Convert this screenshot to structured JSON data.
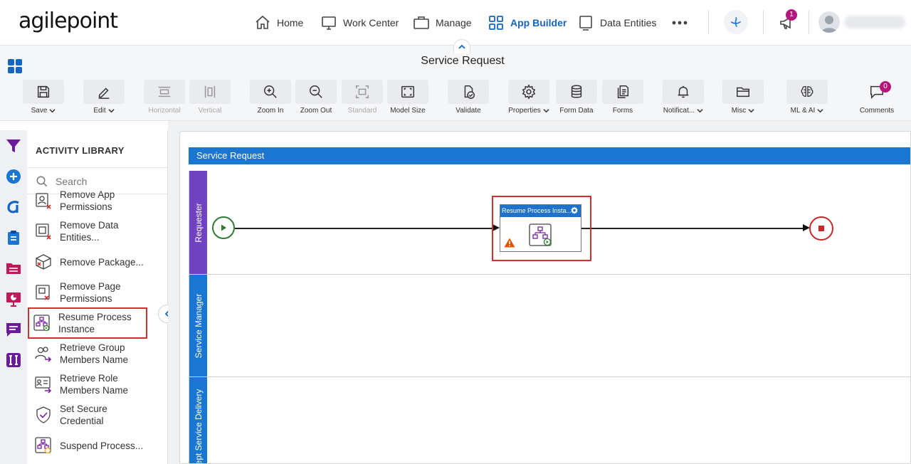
{
  "header": {
    "logo": "agilepoint",
    "nav": [
      {
        "label": "Home",
        "icon": "home-icon"
      },
      {
        "label": "Work Center",
        "icon": "monitor-icon"
      },
      {
        "label": "Manage",
        "icon": "briefcase-icon"
      },
      {
        "label": "App Builder",
        "icon": "app-grid-icon",
        "active": true
      },
      {
        "label": "Data Entities",
        "icon": "data-entities-icon"
      }
    ],
    "notifications_count": "1",
    "accent": "#1565c0"
  },
  "app": {
    "title": "Service Request"
  },
  "toolbar": {
    "buttons": [
      {
        "label": "Save",
        "icon": "save-icon",
        "dropdown": true
      },
      {
        "label": "Edit",
        "icon": "edit-icon",
        "dropdown": true
      },
      {
        "label": "Horizontal",
        "icon": "horizontal-icon",
        "disabled": true
      },
      {
        "label": "Vertical",
        "icon": "vertical-icon",
        "disabled": true
      },
      {
        "label": "Zoom In",
        "icon": "zoom-in-icon"
      },
      {
        "label": "Zoom Out",
        "icon": "zoom-out-icon"
      },
      {
        "label": "Standard",
        "icon": "standard-icon",
        "disabled": true
      },
      {
        "label": "Model Size",
        "icon": "model-size-icon"
      },
      {
        "label": "Validate",
        "icon": "validate-icon"
      },
      {
        "label": "Properties",
        "icon": "gear-icon",
        "dropdown": true
      },
      {
        "label": "Form Data",
        "icon": "database-icon"
      },
      {
        "label": "Forms",
        "icon": "forms-icon"
      },
      {
        "label": "Notificat...",
        "icon": "bell-icon",
        "dropdown": true
      },
      {
        "label": "Misc",
        "icon": "folder-icon",
        "dropdown": true
      },
      {
        "label": "ML & AI",
        "icon": "brain-icon",
        "dropdown": true
      },
      {
        "label": "Comments",
        "icon": "comment-icon",
        "badge": "0"
      }
    ]
  },
  "library": {
    "title": "ACTIVITY LIBRARY",
    "search_placeholder": "Search",
    "items": [
      {
        "label": "Remove App Permissions",
        "icon": "remove-permissions-icon"
      },
      {
        "label": "Remove Data Entities...",
        "icon": "remove-data-entities-icon"
      },
      {
        "label": "Remove Package...",
        "icon": "remove-package-icon"
      },
      {
        "label": "Remove Page Permissions",
        "icon": "remove-page-permissions-icon"
      },
      {
        "label": "Resume Process Instance",
        "icon": "resume-process-icon",
        "selected": true
      },
      {
        "label": "Retrieve Group Members Name",
        "icon": "retrieve-group-icon"
      },
      {
        "label": "Retrieve Role Members Name",
        "icon": "retrieve-role-icon"
      },
      {
        "label": "Set Secure Credential",
        "icon": "shield-check-icon"
      },
      {
        "label": "Suspend Process...",
        "icon": "suspend-process-icon"
      }
    ]
  },
  "canvas": {
    "pool_title": "Service Request",
    "lanes": [
      {
        "label": "Requester",
        "color": "#6f42c1"
      },
      {
        "label": "Service Manager",
        "color": "#1976d2"
      },
      {
        "label": "ept Service Delivery",
        "color": "#1976d2"
      }
    ],
    "activity": {
      "title": "Resume Process Insta...",
      "warning": true
    }
  }
}
